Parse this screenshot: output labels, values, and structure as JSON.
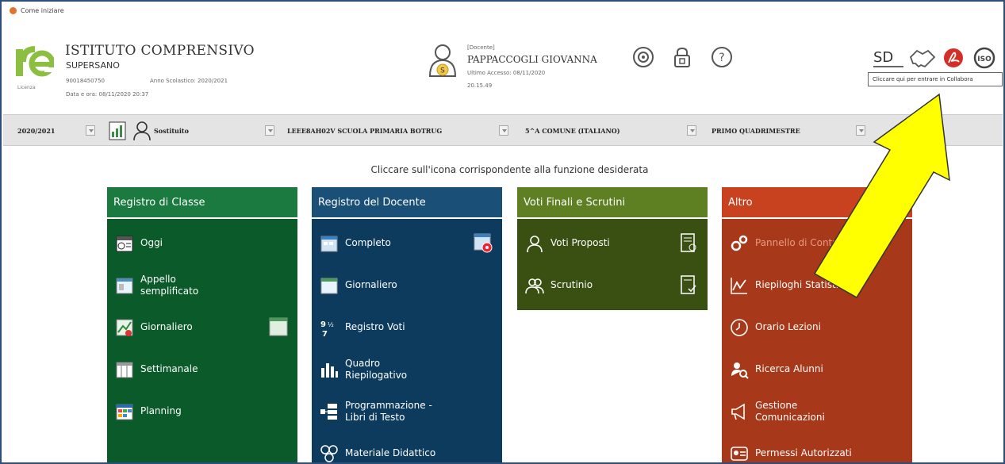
{
  "window": {
    "title": "Come iniziare"
  },
  "school": {
    "logo_sub": "Licenza",
    "name": "ISTITUTO COMPRENSIVO",
    "sub": "SUPERSANO",
    "code": "90018450750",
    "year": "Anno Scolastico: 2020/2021",
    "datetime": "Data e ora: 08/11/2020 20:37"
  },
  "teacher": {
    "role": "[Docente]",
    "name": "PAPPACCOGLI GIOVANNA",
    "last_access": "Ultimo Accesso: 08/11/2020",
    "last_time": "20.15.49",
    "badge": "S"
  },
  "header_icons": [
    "target-icon",
    "lock-icon",
    "help-icon"
  ],
  "top_right": {
    "sd": "SD",
    "iso": "ISO"
  },
  "tooltip": "Cliccare qui per entrare in Collabora",
  "toolbar": {
    "year": "2020/2021",
    "substitute": "Sostituito",
    "school_select": "LEEE8AH02V SCUOLA PRIMARIA BOTRUG",
    "class_select": "5^A COMUNE (ITALIANO)",
    "period_select": "PRIMO QUADRIMESTRE"
  },
  "instruction": "Cliccare sull'icona corrispondente alla funzione desiderata",
  "panels": [
    {
      "title": "Registro di Classe",
      "items": [
        {
          "label": "Oggi",
          "icon": "calendar-today-icon"
        },
        {
          "label": "Appello\nsemplificato",
          "icon": "calendar-check-icon"
        },
        {
          "label": "Giornaliero",
          "icon": "chart-edit-icon"
        },
        {
          "label": "Settimanale",
          "icon": "calendar-week-icon"
        },
        {
          "label": "Planning",
          "icon": "planning-grid-icon"
        }
      ]
    },
    {
      "title": "Registro del Docente",
      "items": [
        {
          "label": "Completo",
          "icon": "calendar-full-icon"
        },
        {
          "label": "Giornaliero",
          "icon": "calendar-day-icon"
        },
        {
          "label": "Registro Voti",
          "icon": "grades-icon"
        },
        {
          "label": "Quadro\nRiepilogativo",
          "icon": "bar-chart-icon"
        },
        {
          "label": "Programmazione -\nLibri di Testo",
          "icon": "program-icon"
        },
        {
          "label": "Materiale Didattico",
          "icon": "teaching-material-icon"
        }
      ]
    },
    {
      "title": "Voti Finali e Scrutini",
      "items": [
        {
          "label": "Voti Proposti",
          "icon": "user-outline-icon"
        },
        {
          "label": "Scrutinio",
          "icon": "users-outline-icon"
        }
      ]
    },
    {
      "title": "Altro",
      "items": [
        {
          "label": "Pannello di Controllo",
          "icon": "gears-icon"
        },
        {
          "label": "Riepiloghi Statistici",
          "icon": "statistics-icon"
        },
        {
          "label": "Orario Lezioni",
          "icon": "clock-icon"
        },
        {
          "label": "Ricerca Alunni",
          "icon": "search-user-icon"
        },
        {
          "label": "Gestione\nComunicazioni",
          "icon": "megaphone-icon"
        },
        {
          "label": "Permessi Autorizzati",
          "icon": "permits-icon"
        }
      ]
    }
  ],
  "colors": {
    "panel1_header": "#1a7a3f",
    "panel1_body": "#0b5a2a",
    "panel2_header": "#1a4f78",
    "panel2_body": "#0d3b5e",
    "panel3_header": "#5e7f22",
    "panel3_body": "#3a5012",
    "panel4_header": "#c8421f",
    "panel4_body": "#a8381a",
    "arrow": "#ffff00"
  }
}
